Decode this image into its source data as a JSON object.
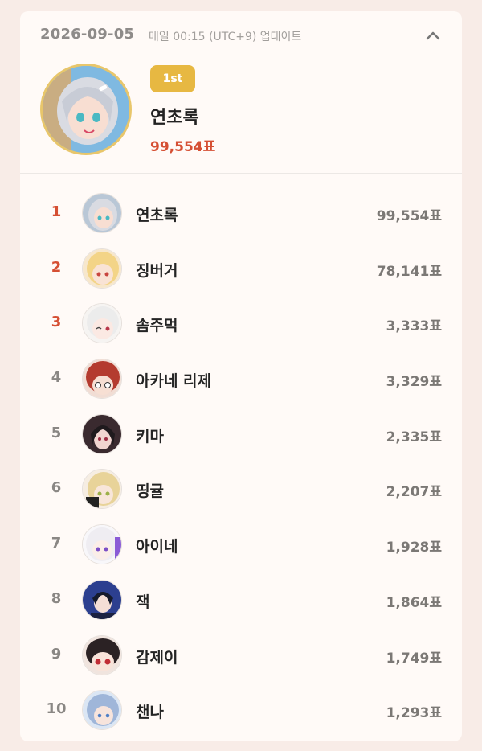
{
  "header": {
    "date": "2026-09-05",
    "update_text": "매일 00:15 (UTC+9) 업데이트",
    "collapse_icon": "chevron-up-icon"
  },
  "top1": {
    "badge": "1st",
    "name": "연초록",
    "votes": "99,554표",
    "badge_color": "#e7b842",
    "votes_color": "#d54f33"
  },
  "ranking": [
    {
      "rank": "1",
      "name": "연초록",
      "votes": "99,554표",
      "avatar_color": "#b9c7d6"
    },
    {
      "rank": "2",
      "name": "징버거",
      "votes": "78,141표",
      "avatar_color": "#f3d487"
    },
    {
      "rank": "3",
      "name": "솜주먹",
      "votes": "3,333표",
      "avatar_color": "#ececec"
    },
    {
      "rank": "4",
      "name": "아카네 리제",
      "votes": "3,329표",
      "avatar_color": "#b43b2f"
    },
    {
      "rank": "5",
      "name": "키마",
      "votes": "2,335표",
      "avatar_color": "#3a2a2f"
    },
    {
      "rank": "6",
      "name": "띵귤",
      "votes": "2,207표",
      "avatar_color": "#e8d399"
    },
    {
      "rank": "7",
      "name": "아이네",
      "votes": "1,928표",
      "avatar_color": "#efedf2"
    },
    {
      "rank": "8",
      "name": "잭",
      "votes": "1,864표",
      "avatar_color": "#2c3f8f"
    },
    {
      "rank": "9",
      "name": "감제이",
      "votes": "1,749표",
      "avatar_color": "#2b2224"
    },
    {
      "rank": "10",
      "name": "챈나",
      "votes": "1,293표",
      "avatar_color": "#9fb6d9"
    }
  ]
}
